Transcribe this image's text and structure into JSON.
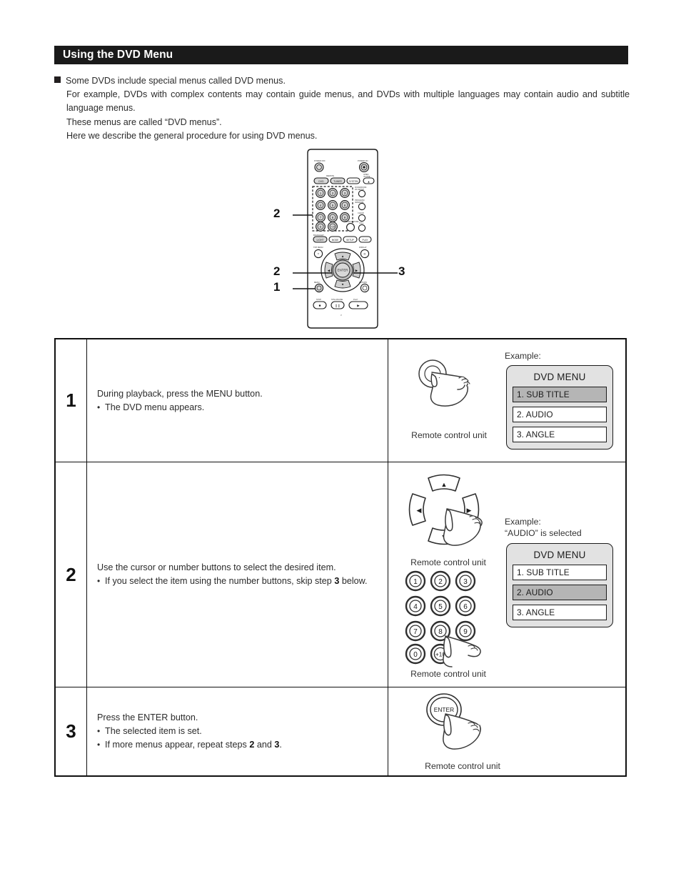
{
  "section": {
    "title": "Using the DVD Menu"
  },
  "intro": {
    "bullet_icon": "filled-square-bullet",
    "line1": "Some DVDs include special menus called DVD menus.",
    "line2": "For example, DVDs with complex contents may contain guide menus, and DVDs with multiple languages may contain audio and subtitle language menus.",
    "line3": "These menus are called “DVD menus”.",
    "line4": "Here we describe the general procedure for using DVD menus."
  },
  "remote_figure": {
    "name": "remote-control-diagram",
    "callouts": [
      {
        "label": "2",
        "target": "number-buttons"
      },
      {
        "label": "2",
        "target": "cursor-buttons"
      },
      {
        "label": "1",
        "target": "menu-button"
      },
      {
        "label": "3",
        "target": "enter-button"
      }
    ],
    "buttons": {
      "power_off": "POWER OFF",
      "power_on": "POWER ON",
      "enter": "ENTER",
      "menu": "MENU",
      "top_menu": "TOP MENU",
      "return": "RETURN",
      "display": "DISPLAY",
      "stop": "STOP",
      "still_pause": "STILL/PAUSE",
      "play": "PLAY",
      "number_keys": [
        "1",
        "2",
        "3",
        "4",
        "5",
        "6",
        "7",
        "8",
        "9",
        "0",
        "+10"
      ]
    }
  },
  "procedure": {
    "rows": [
      {
        "number": "1",
        "text_lines": [
          {
            "type": "plain",
            "text": "During playback, press the MENU button."
          },
          {
            "type": "bullet",
            "text": "The DVD menu appears."
          }
        ],
        "illustration": {
          "type": "hand-pressing-round-button",
          "caption": "Remote control unit"
        },
        "example": {
          "label": "Example:",
          "note": "",
          "menu_title": "DVD MENU",
          "items": [
            {
              "label": "1. SUB TITLE",
              "selected": true
            },
            {
              "label": "2. AUDIO",
              "selected": false
            },
            {
              "label": "3. ANGLE",
              "selected": false
            }
          ]
        }
      },
      {
        "number": "2",
        "text_lines": [
          {
            "type": "plain",
            "text": "Use the cursor or number buttons to select the desired item."
          },
          {
            "type": "bullet_justified",
            "pre": "If you select the item using the number buttons, skip step ",
            "bold": "3",
            "post": " below."
          }
        ],
        "illustration": {
          "type": "cursor-pad-and-keypad",
          "caption_top": "Remote control unit",
          "caption_bottom": "Remote control unit",
          "keypad": [
            "1",
            "2",
            "3",
            "4",
            "5",
            "6",
            "7",
            "8",
            "9",
            "0",
            "+10"
          ]
        },
        "example": {
          "label": "Example:",
          "note": "“AUDIO” is selected",
          "menu_title": "DVD MENU",
          "items": [
            {
              "label": "1. SUB TITLE",
              "selected": false
            },
            {
              "label": "2. AUDIO",
              "selected": true
            },
            {
              "label": "3. ANGLE",
              "selected": false
            }
          ]
        }
      },
      {
        "number": "3",
        "text_lines": [
          {
            "type": "plain",
            "text": "Press the ENTER button."
          },
          {
            "type": "bullet",
            "text": "The selected item is set."
          },
          {
            "type": "bullet_repeat",
            "pre": "If more menus appear, repeat steps ",
            "bold1": "2",
            "mid": " and ",
            "bold2": "3",
            "post": "."
          }
        ],
        "illustration": {
          "type": "hand-pressing-enter-button",
          "button_label": "ENTER",
          "caption": "Remote control unit"
        }
      }
    ]
  },
  "colors": {
    "header_bar": "#1a1a1a",
    "header_text": "#ffffff",
    "body_text": "#2b2b2b",
    "osd_background": "#e2e2e2",
    "osd_item_background": "#ffffff",
    "osd_item_selected": "#b5b5b5",
    "border": "#111111"
  }
}
